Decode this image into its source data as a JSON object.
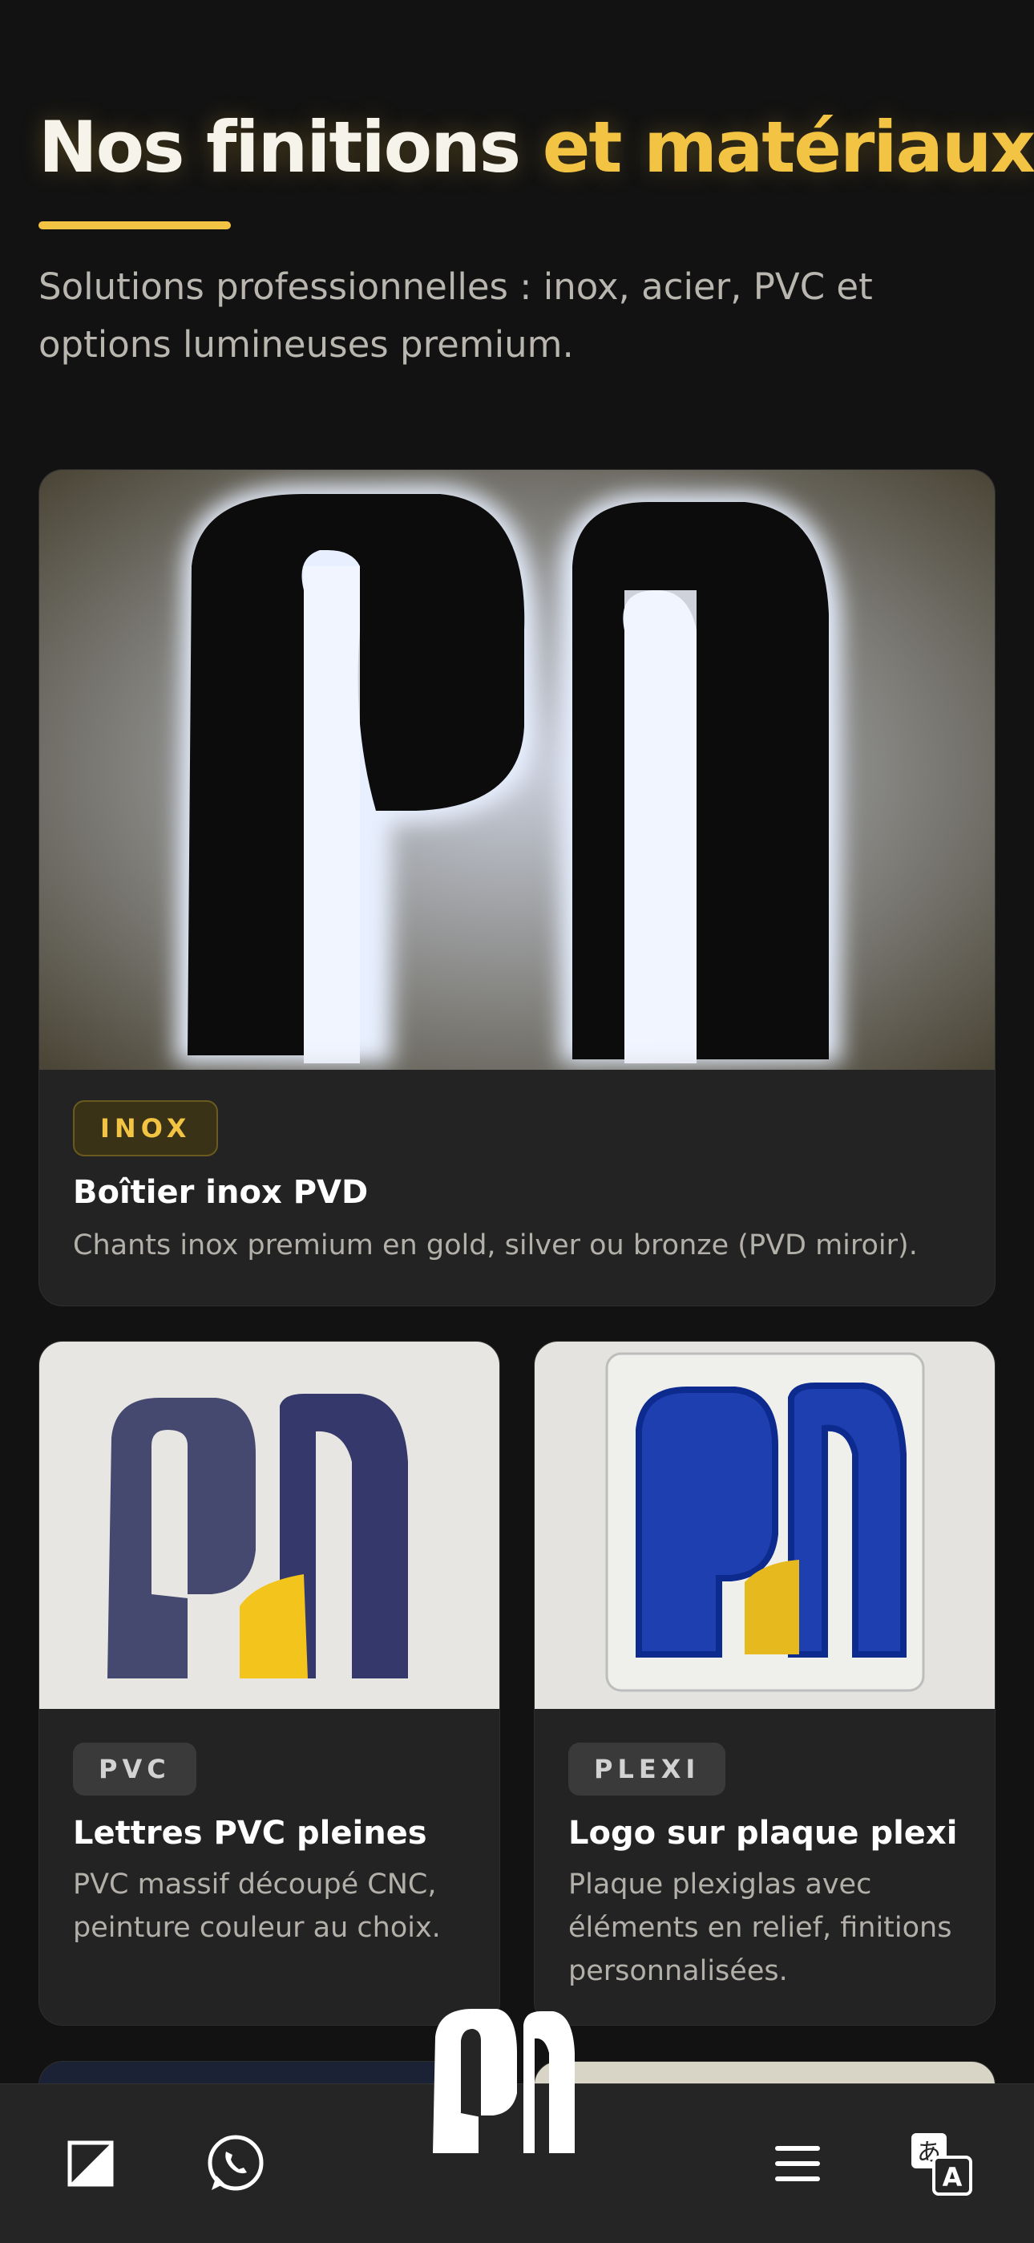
{
  "header": {
    "title_main": "Nos finitions",
    "title_accent": "et matériaux",
    "subtitle": "Solutions professionnelles : inox, acier, PVC et options lumineuses premium."
  },
  "cards": [
    {
      "badge": "INOX",
      "title": "Boîtier inox PVD",
      "description": "Chants inox premium en gold, silver ou bronze (PVD miroir)."
    },
    {
      "badge": "PVC",
      "title": "Lettres PVC pleines",
      "description": "PVC massif découpé CNC, peinture couleur au choix."
    },
    {
      "badge": "PLEXI",
      "title": "Logo sur plaque plexi",
      "description": "Plaque plexiglas avec éléments en relief, finitions personnalisées."
    }
  ],
  "bottom_nav": {
    "icons": [
      "theme-toggle-icon",
      "whatsapp-icon",
      "brand-logo-icon",
      "menu-icon",
      "translate-icon"
    ]
  },
  "colors": {
    "accent": "#f3c443",
    "background": "#121212",
    "card": "#232323"
  }
}
